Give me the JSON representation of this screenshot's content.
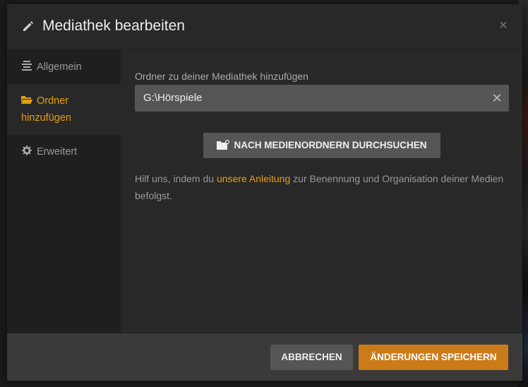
{
  "dialog": {
    "title": "Mediathek bearbeiten",
    "close_label": "×"
  },
  "sidebar": {
    "items": [
      {
        "label": "Allgemein",
        "icon": "general-lines-icon",
        "active": false
      },
      {
        "label": "Ordner hinzufügen",
        "icon": "folder-open-icon",
        "active": true
      },
      {
        "label": "Erweitert",
        "icon": "gear-icon",
        "active": false
      }
    ]
  },
  "main": {
    "field_label": "Ordner zu deiner Mediathek hinzufügen",
    "path_value": "G:\\Hörspiele",
    "clear_label": "✕",
    "browse_button_label": "NACH MEDIENORDNERN DURCHSUCHEN",
    "help": {
      "before": "Hilf uns, indem du ",
      "link": "unsere Anleitung",
      "after": " zur Benennung und Organisation deiner Medien befolgst."
    }
  },
  "footer": {
    "cancel_label": "ABBRECHEN",
    "save_label": "ÄNDERUNGEN SPEICHERN"
  },
  "colors": {
    "accent": "#e5a00d",
    "save_button": "#cc7b19",
    "modal_bg": "#282828",
    "sidebar_bg": "#1f1f1f",
    "footer_bg": "#3a3a3a"
  }
}
